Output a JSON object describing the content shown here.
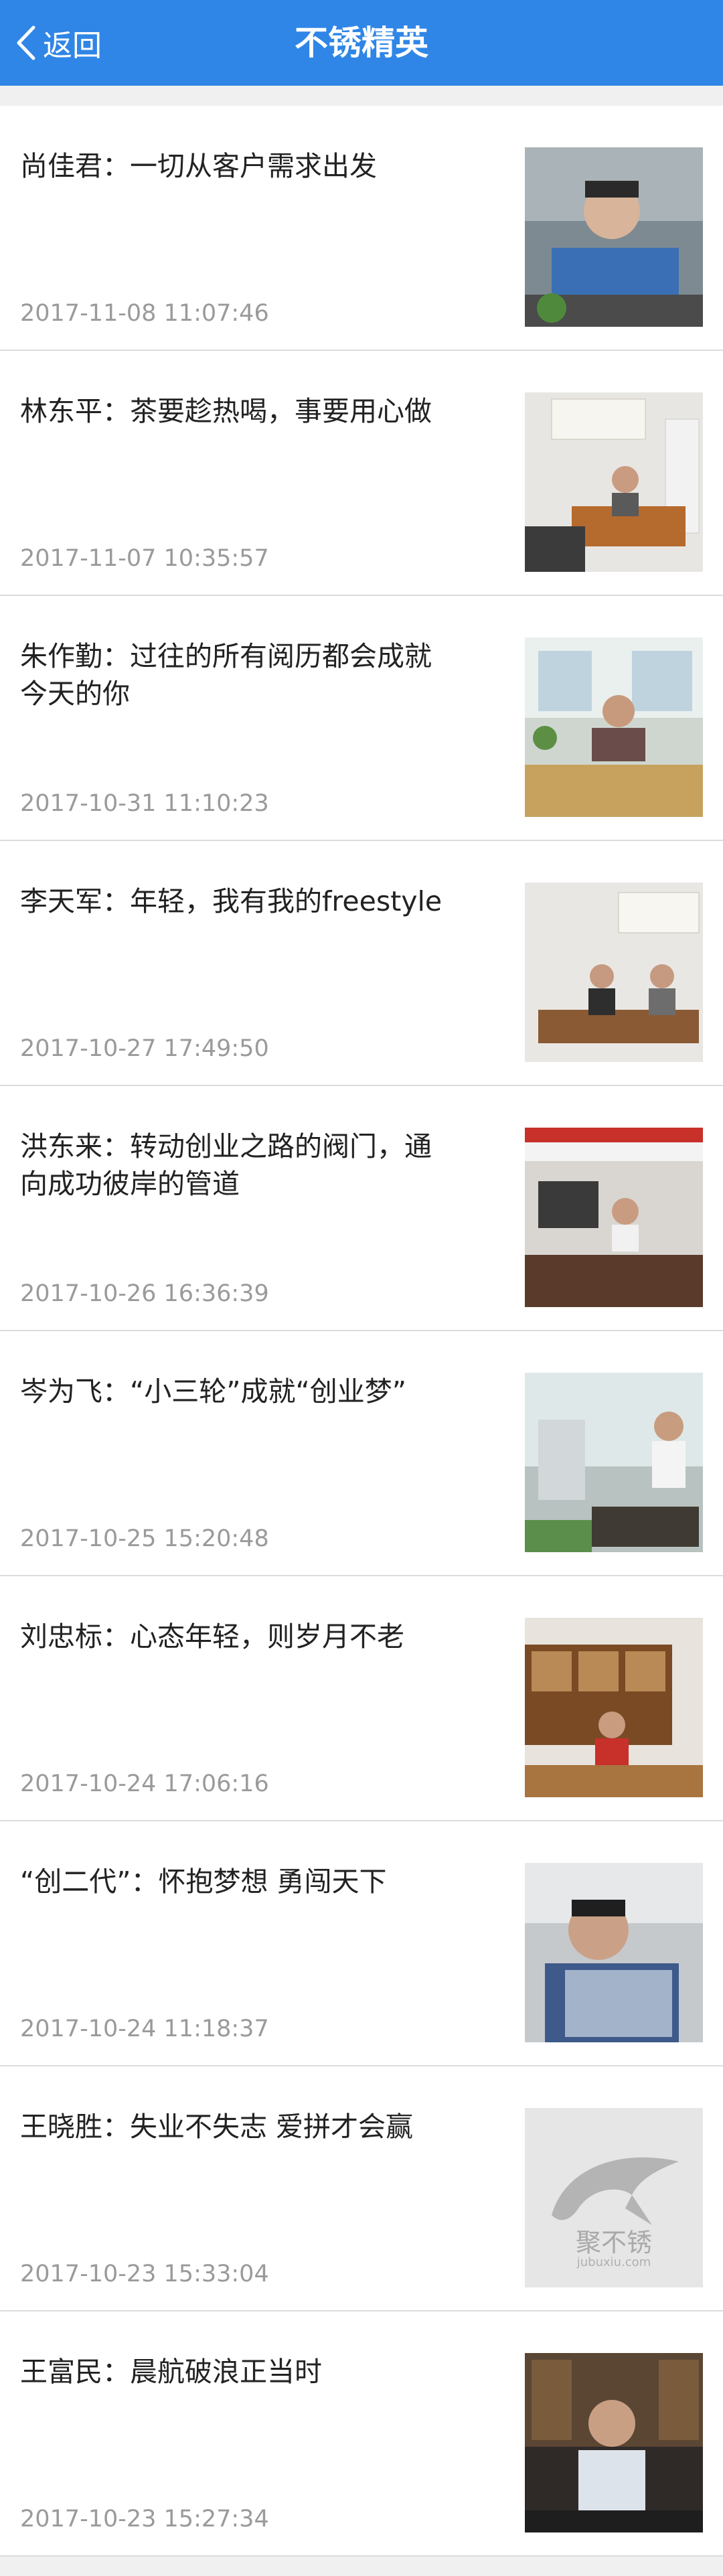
{
  "header": {
    "back_label": "返回",
    "title": "不锈精英"
  },
  "articles": [
    {
      "title": "尚佳君：一切从客户需求出发",
      "date": "2017-11-08 11:07:46"
    },
    {
      "title": "林东平：茶要趁热喝，事要用心做",
      "date": "2017-11-07 10:35:57"
    },
    {
      "title": "朱作勤：过往的所有阅历都会成就今天的你",
      "date": "2017-10-31 11:10:23"
    },
    {
      "title": "李天军：年轻，我有我的freestyle",
      "date": "2017-10-27 17:49:50"
    },
    {
      "title": "洪东来：转动创业之路的阀门，通向成功彼岸的管道",
      "date": "2017-10-26 16:36:39"
    },
    {
      "title": "岑为飞：“小三轮”成就“创业梦”",
      "date": "2017-10-25 15:20:48"
    },
    {
      "title": "刘忠标：心态年轻，则岁月不老",
      "date": "2017-10-24 17:06:16"
    },
    {
      "title": "“创二代”：怀抱梦想 勇闯天下",
      "date": "2017-10-24 11:18:37"
    },
    {
      "title": "王晓胜：失业不失志 爱拼才会赢",
      "date": "2017-10-23 15:33:04"
    },
    {
      "title": "王富民：晨航破浪正当时",
      "date": "2017-10-23 15:27:34"
    }
  ],
  "thumb_logo": {
    "brand": "聚不锈",
    "url": "jubuxiu.com"
  },
  "colors": {
    "header": "#2f86e6",
    "date": "#9a9a9a"
  }
}
